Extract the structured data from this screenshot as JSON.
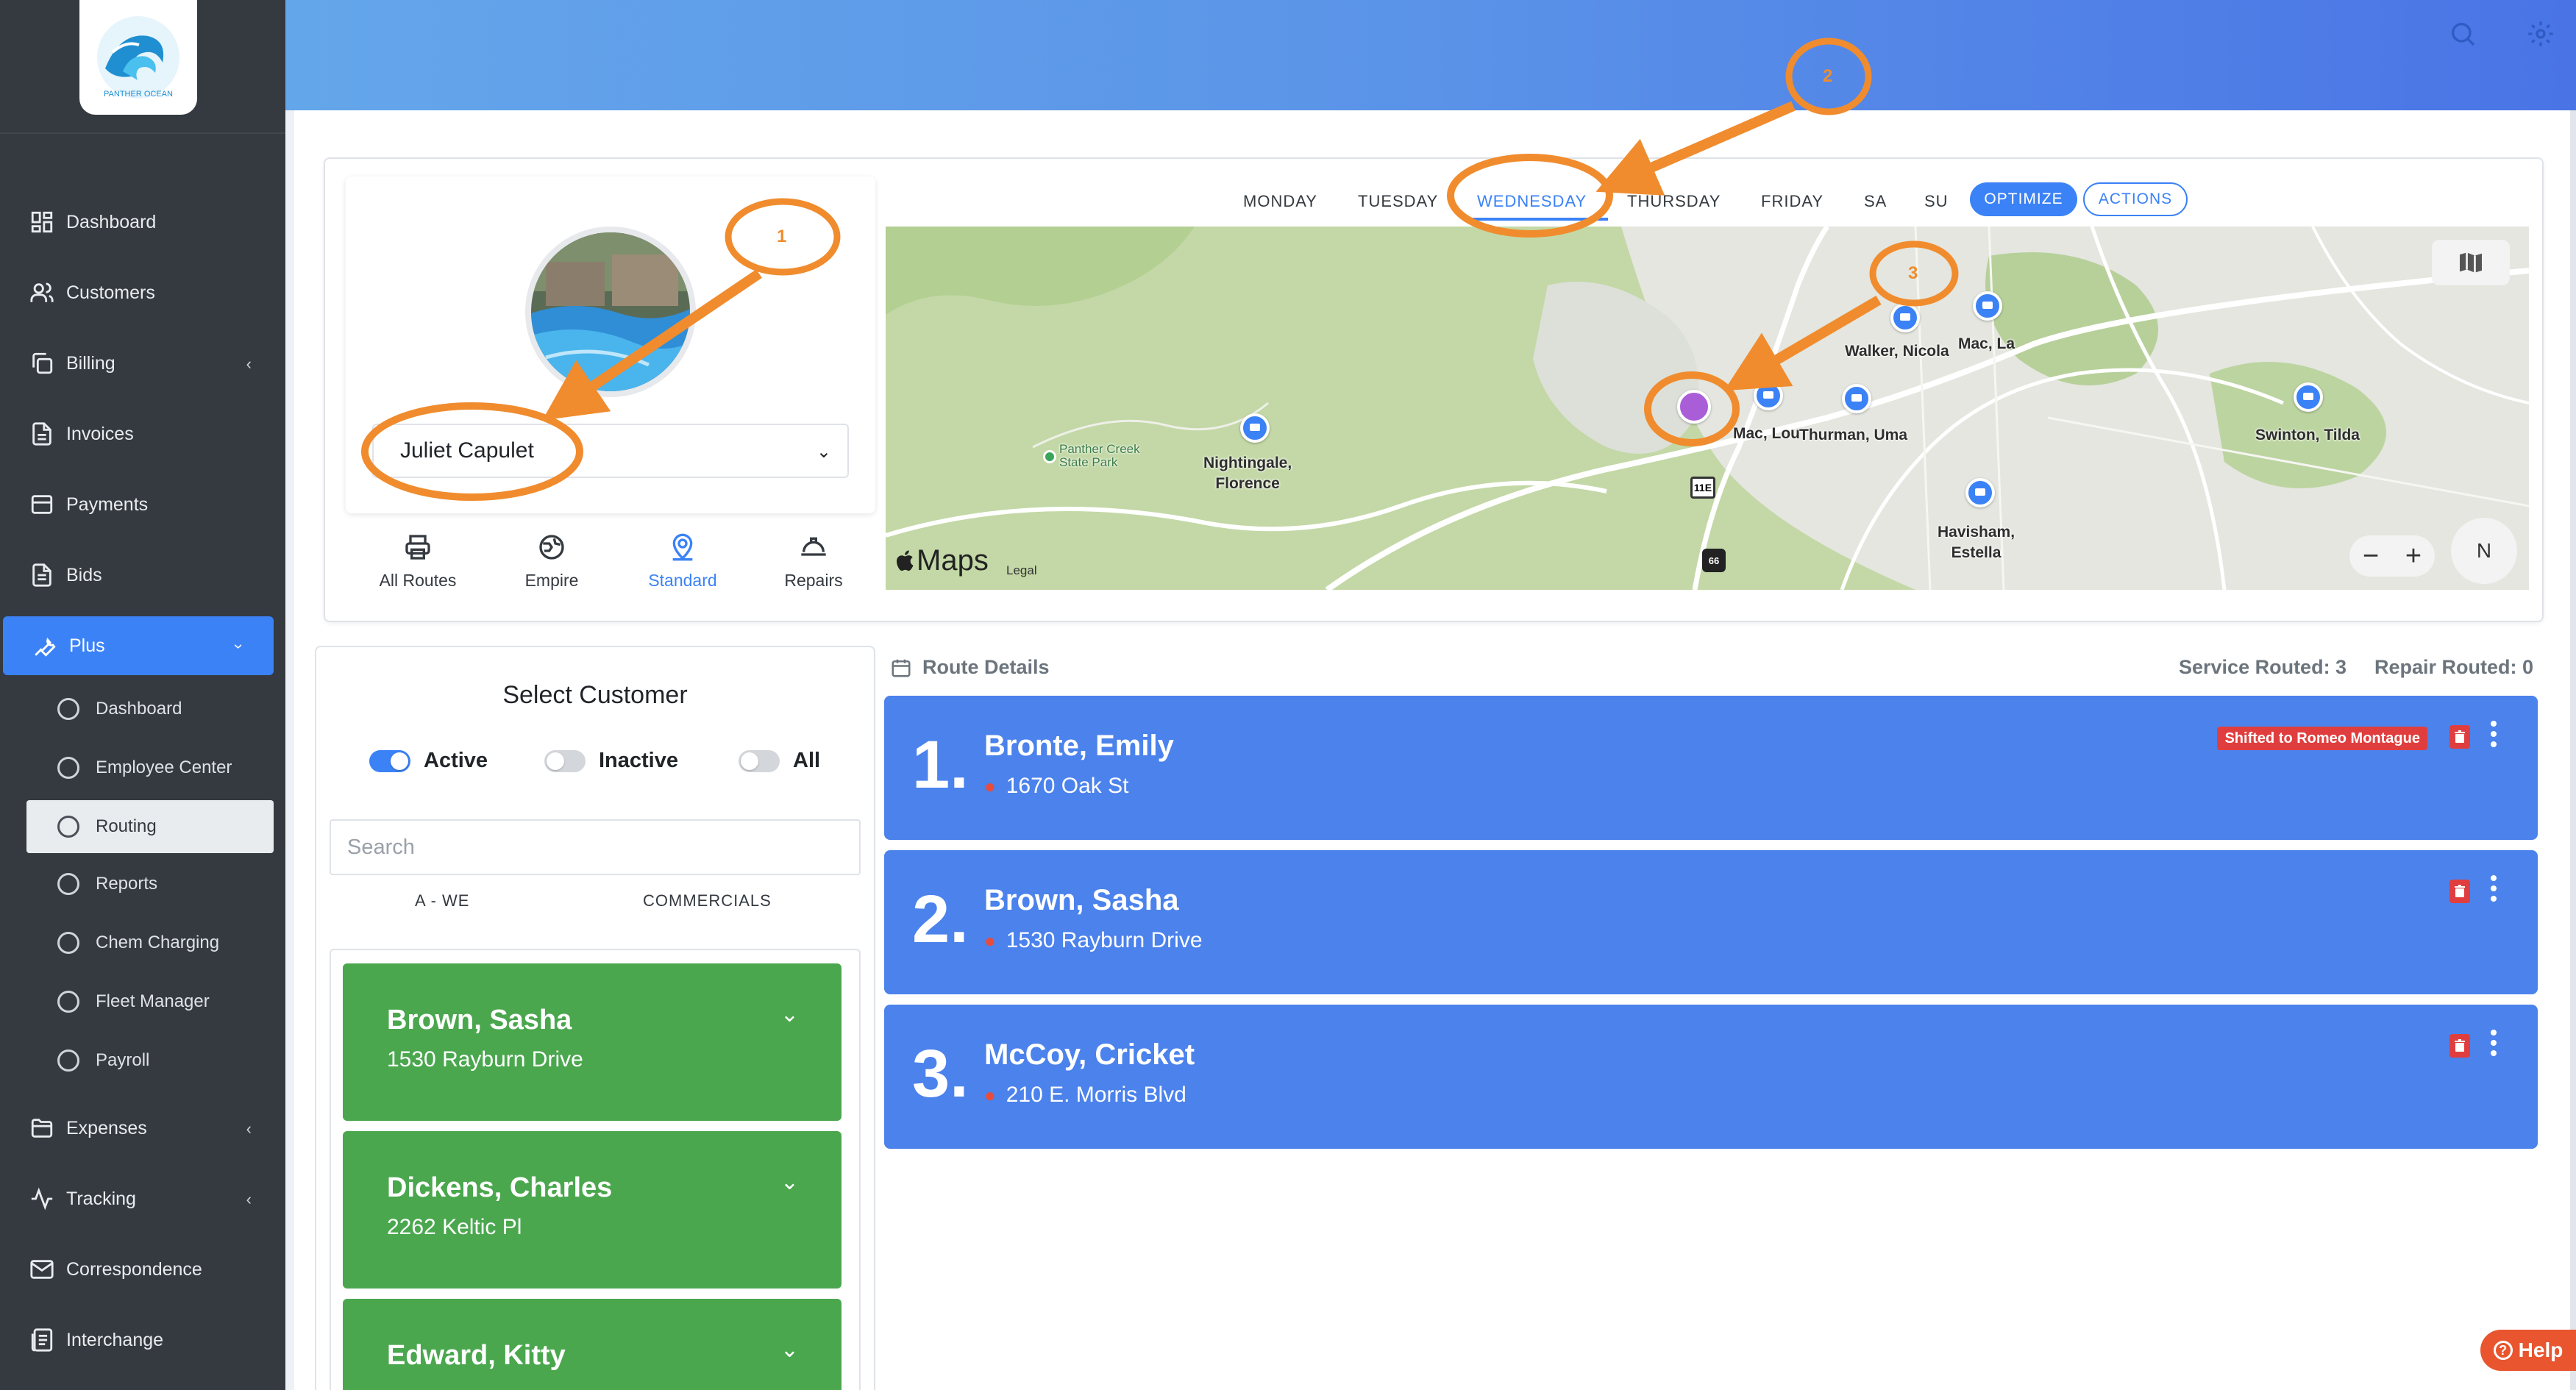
{
  "brand": {
    "logo_text": "PANTHER OCEAN"
  },
  "sidebar": {
    "items": [
      {
        "label": "Dashboard",
        "icon": "grid-icon"
      },
      {
        "label": "Customers",
        "icon": "users-icon"
      },
      {
        "label": "Billing",
        "icon": "copy-icon"
      },
      {
        "label": "Invoices",
        "icon": "file-icon"
      },
      {
        "label": "Payments",
        "icon": "envelope-icon"
      },
      {
        "label": "Bids",
        "icon": "file-text-icon"
      },
      {
        "label": "Plus",
        "icon": "wrench-icon"
      },
      {
        "label": "Expenses",
        "icon": "folder-icon"
      },
      {
        "label": "Tracking",
        "icon": "activity-icon"
      },
      {
        "label": "Correspondence",
        "icon": "mail-icon"
      },
      {
        "label": "Interchange",
        "icon": "list-icon"
      }
    ],
    "plus_sub": [
      "Dashboard",
      "Employee Center",
      "Routing",
      "Reports",
      "Chem Charging",
      "Fleet Manager",
      "Payroll"
    ]
  },
  "customer": {
    "selected_name": "Juliet Capulet"
  },
  "route_types": [
    {
      "label": "All Routes",
      "icon": "printer-icon"
    },
    {
      "label": "Empire",
      "icon": "globe-icon"
    },
    {
      "label": "Standard",
      "icon": "map-pin-icon"
    },
    {
      "label": "Repairs",
      "icon": "hard-hat-icon"
    }
  ],
  "days": [
    "MONDAY",
    "TUESDAY",
    "WEDNESDAY",
    "THURSDAY",
    "FRIDAY",
    "SA",
    "SU"
  ],
  "selected_day": "WEDNESDAY",
  "buttons": {
    "optimize": "OPTIMIZE",
    "actions": "ACTIONS"
  },
  "map": {
    "attribution": "Maps",
    "legal": "Legal",
    "compass": "N",
    "park_label": "Panther Creek State Park",
    "park_line1": "Panther Creek",
    "park_line2": "State Park",
    "road_1": "11E",
    "road_2": "66",
    "stops": [
      {
        "line1": "Nightingale,",
        "line2": "Florence"
      },
      {
        "line1": "Walker, Nicola",
        "line2": ""
      },
      {
        "line1": "Mac, La",
        "line2": ""
      },
      {
        "line1": "Mac, Lou",
        "line2": ""
      },
      {
        "line1": "Thurman, Uma",
        "line2": ""
      },
      {
        "line1": "Swinton, Tilda",
        "line2": ""
      },
      {
        "line1": "Havisham,",
        "line2": "Estella"
      }
    ]
  },
  "select_customer": {
    "title": "Select Customer",
    "filters": [
      "Active",
      "Inactive",
      "All"
    ],
    "search_placeholder": "Search",
    "tabs": [
      "A - WE",
      "COMMERCIALS"
    ],
    "customers": [
      {
        "name": "Brown, Sasha",
        "address": "1530 Rayburn Drive"
      },
      {
        "name": "Dickens, Charles",
        "address": "2262 Keltic Pl"
      },
      {
        "name": "Edward, Kitty",
        "address": ""
      }
    ]
  },
  "route_details": {
    "title": "Route Details",
    "service_routed": "Service Routed: 3",
    "repair_routed": "Repair Routed: 0",
    "stops": [
      {
        "num": "1.",
        "name": "Bronte, Emily",
        "address": "1670 Oak St",
        "badge": "Shifted to Romeo Montague"
      },
      {
        "num": "2.",
        "name": "Brown, Sasha",
        "address": "1530 Rayburn Drive",
        "badge": ""
      },
      {
        "num": "3.",
        "name": "McCoy, Cricket",
        "address": "210 E. Morris Blvd",
        "badge": ""
      }
    ]
  },
  "annotations": [
    "1",
    "2",
    "3"
  ],
  "help": {
    "label": "Help"
  },
  "colors": {
    "sidebar": "#343a40",
    "accent": "#3b82f6",
    "route_card": "#4b82ec",
    "customer_card": "#4aa74e",
    "annotation": "#f08c2e",
    "danger": "#e03e3e"
  }
}
